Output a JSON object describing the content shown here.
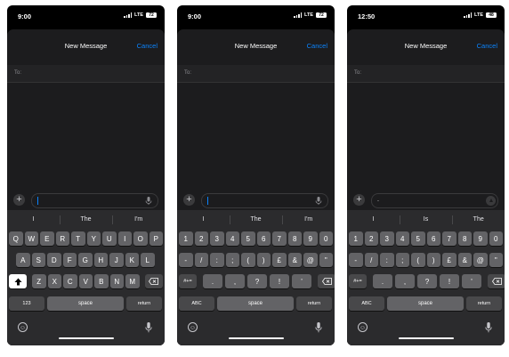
{
  "screens": [
    {
      "status": {
        "time": "9:00",
        "network": "LTE",
        "battery": "72"
      },
      "header": {
        "title": "New Message",
        "cancel_label": "Cancel"
      },
      "to_label": "To:",
      "message_text": "",
      "suggestions": [
        "I",
        "The",
        "I'm"
      ],
      "keys": {
        "row1": [
          "Q",
          "W",
          "E",
          "R",
          "T",
          "Y",
          "U",
          "I",
          "O",
          "P"
        ],
        "row2": [
          "A",
          "S",
          "D",
          "F",
          "G",
          "H",
          "J",
          "K",
          "L"
        ],
        "row3": [
          "Z",
          "X",
          "C",
          "V",
          "B",
          "N",
          "M"
        ],
        "mode_label": "123",
        "space_label": "space",
        "return_label": "return"
      }
    },
    {
      "status": {
        "time": "9:00",
        "network": "LTE",
        "battery": "72"
      },
      "header": {
        "title": "New Message",
        "cancel_label": "Cancel"
      },
      "to_label": "To:",
      "message_text": "",
      "suggestions": [
        "I",
        "The",
        "I'm"
      ],
      "keys": {
        "row1": [
          "1",
          "2",
          "3",
          "4",
          "5",
          "6",
          "7",
          "8",
          "9",
          "0"
        ],
        "row2": [
          "-",
          "/",
          ":",
          ";",
          "(",
          ")",
          "£",
          "&",
          "@",
          "\""
        ],
        "symbols_label": "#+=",
        "row3": [
          ".",
          ",",
          "?",
          "!",
          "’"
        ],
        "mode_label": "ABC",
        "space_label": "space",
        "return_label": "return"
      }
    },
    {
      "status": {
        "time": "12:50",
        "network": "LTE",
        "battery": "48"
      },
      "header": {
        "title": "New Message",
        "cancel_label": "Cancel"
      },
      "to_label": "To:",
      "message_text": ".",
      "suggestions": [
        "I",
        "Is",
        "The"
      ],
      "keys": {
        "row1": [
          "1",
          "2",
          "3",
          "4",
          "5",
          "6",
          "7",
          "8",
          "9",
          "0"
        ],
        "row2": [
          "-",
          "/",
          ":",
          ";",
          "(",
          ")",
          "£",
          "&",
          "@",
          "\""
        ],
        "symbols_label": "#+=",
        "row3": [
          ".",
          ",",
          "?",
          "!",
          "'"
        ],
        "mode_label": "ABC",
        "space_label": "space",
        "return_label": "return"
      }
    }
  ],
  "colors": {
    "accent": "#0a84ff",
    "key": "#636366",
    "key_dark": "#48484a",
    "sheet": "#1c1c1e"
  },
  "icons": [
    "signal-icon",
    "battery-icon",
    "plus-icon",
    "mic-icon",
    "send-icon",
    "shift-icon",
    "delete-icon",
    "emoji-icon"
  ]
}
